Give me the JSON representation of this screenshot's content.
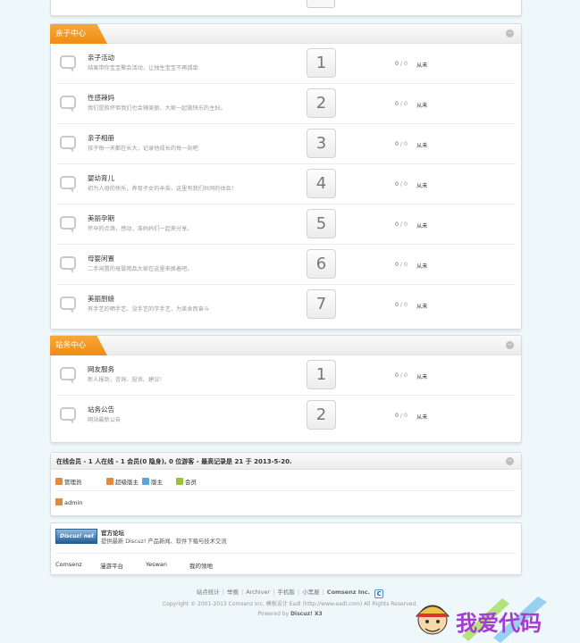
{
  "sections": [
    {
      "title": "亲子中心",
      "forums": [
        {
          "name": "亲子活动",
          "desc": "结果带你宝宝聚会活动，让独生宝宝不再孤单",
          "num": "1",
          "stat_a": "0",
          "stat_b": "0",
          "last": "从未"
        },
        {
          "name": "性感辣妈",
          "desc": "我们是败坏但我们也会辣美丽，大家一起做快乐的主妇。",
          "num": "2",
          "stat_a": "0",
          "stat_b": "0",
          "last": "从未"
        },
        {
          "name": "亲子相册",
          "desc": "孩子每一天都在长大，记录他成长的每一刻吧",
          "num": "3",
          "stat_a": "0",
          "stat_b": "0",
          "last": "从未"
        },
        {
          "name": "婴幼育儿",
          "desc": "初为人母的快乐，养育子女的辛苦，这里有我们共同的体会！",
          "num": "4",
          "stat_a": "0",
          "stat_b": "0",
          "last": "从未"
        },
        {
          "name": "美丽孕期",
          "desc": "怀孕的点滴，感动，准妈妈们一起来分享。",
          "num": "5",
          "stat_a": "0",
          "stat_b": "0",
          "last": "从未"
        },
        {
          "name": "母婴闲置",
          "desc": "二手闲置的母婴用品大家在这里来换着吧。",
          "num": "6",
          "stat_a": "0",
          "stat_b": "0",
          "last": "从未"
        },
        {
          "name": "美丽厨娘",
          "desc": "有手艺的晒手艺，没手艺的学手艺，为美食而奋斗",
          "num": "7",
          "stat_a": "0",
          "stat_b": "0",
          "last": "从未"
        }
      ]
    },
    {
      "title": "站务中心",
      "forums": [
        {
          "name": "网友服务",
          "desc": "新人报到，咨询、投诉、建议！",
          "num": "1",
          "stat_a": "0",
          "stat_b": "0",
          "last": "从未"
        },
        {
          "name": "站务公告",
          "desc": "网站最新公告",
          "num": "2",
          "stat_a": "0",
          "stat_b": "0",
          "last": "从未"
        }
      ]
    }
  ],
  "online": {
    "summary": "在线会员 - 1 人在线 - 1 会员(0 隐身), 0 位游客 - 最高记录是 21 于 2013-5-20.",
    "legend": [
      {
        "label": "管理员",
        "color": "#e38a3c"
      },
      {
        "label": "超级版主",
        "color": "#e38a3c"
      },
      {
        "label": "版主",
        "color": "#5aa6d6"
      },
      {
        "label": "会员",
        "color": "#9ac23c"
      }
    ],
    "user": "admin"
  },
  "links_box": {
    "logo_text": "Discuz! net",
    "title": "官方论坛",
    "desc": "提供最新 Discuz! 产品新闻、软件下载与技术交流",
    "links": [
      "Comsenz",
      "漫游平台",
      "Yeswan",
      "我的领地"
    ]
  },
  "footer": {
    "nav": [
      "站点统计",
      "举报",
      "Archiver",
      "手机版",
      "小黑屋"
    ],
    "brand": "Comsenz Inc.",
    "copyright": "Copyright © 2001-2013 Comsenz Inc.  模板设计 Eadl (http://www.eadl.com) All Rights Reserved.",
    "powered_prefix": "Powered by ",
    "powered_name": "Discuz! X3"
  },
  "watermark": {
    "text": "我爱代码"
  }
}
